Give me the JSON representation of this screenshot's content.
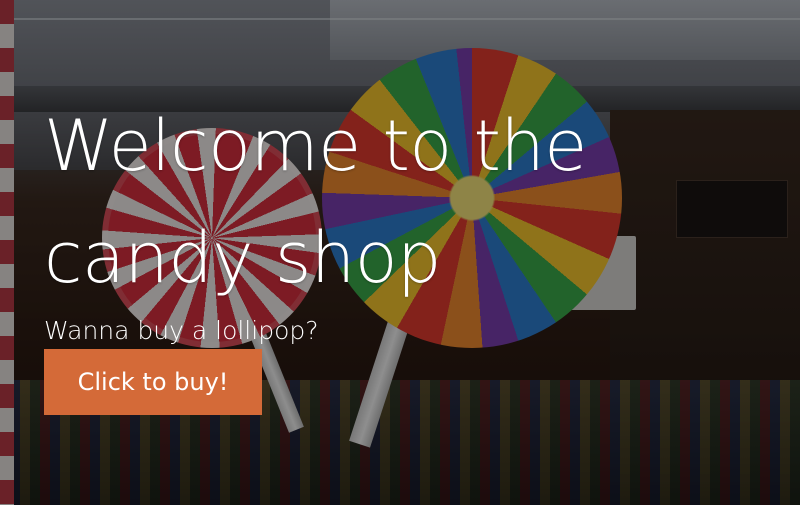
{
  "hero": {
    "title": "Welcome to the candy shop",
    "subtitle": "Wanna buy a lollipop?",
    "cta_label": "Click to buy!"
  },
  "colors": {
    "button_bg": "#d46a38",
    "text": "#ffffff"
  }
}
